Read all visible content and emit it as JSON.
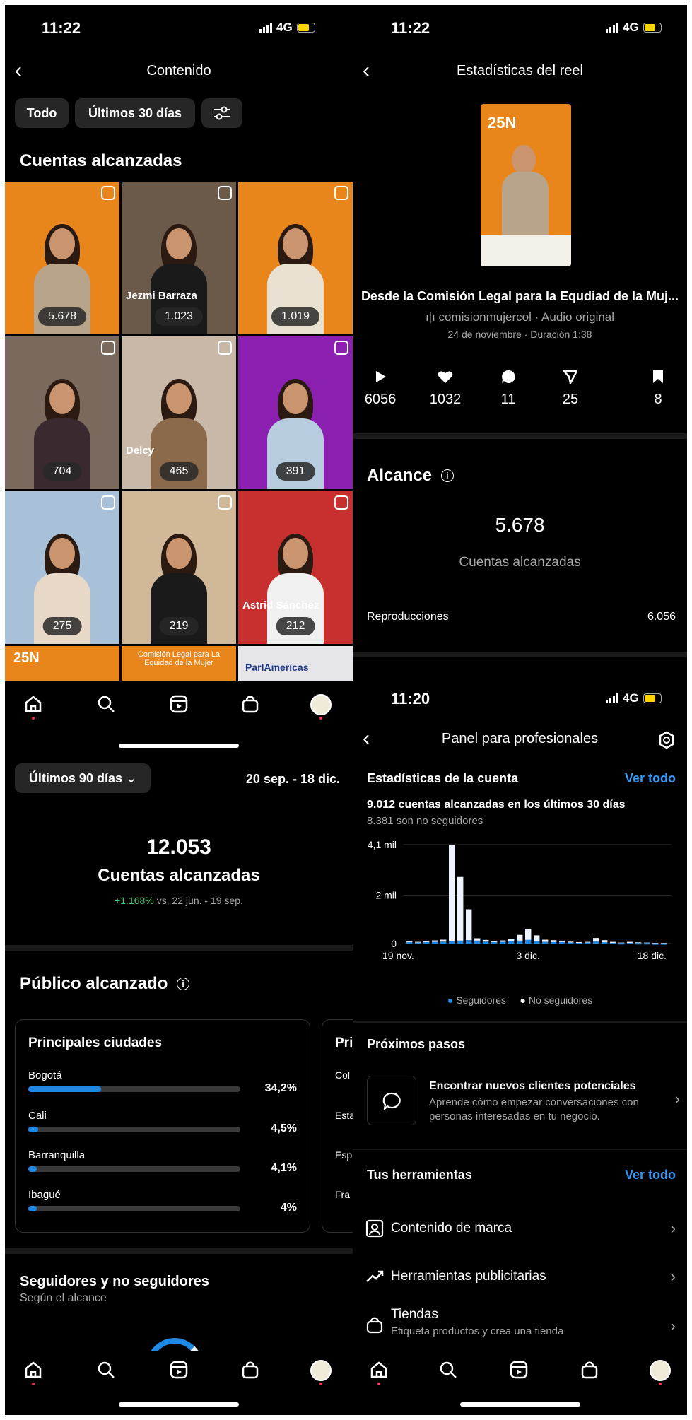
{
  "status": {
    "time_a": "11:22",
    "time_b": "11:22",
    "time_c": "11:20",
    "network": "4G"
  },
  "content": {
    "title": "Contenido",
    "filters": [
      "Todo",
      "Últimos 30 días"
    ],
    "section_title": "Cuentas alcanzadas",
    "tiles": [
      {
        "count": "5.678",
        "bg": "#e8861c",
        "body": "#b8a48a",
        "caption": ""
      },
      {
        "count": "1.023",
        "bg": "#6b5a4a",
        "body": "#1a1a1a",
        "caption": "Jezmi Barraza"
      },
      {
        "count": "1.019",
        "bg": "#e8861c",
        "body": "#e8e0d0",
        "caption": ""
      },
      {
        "count": "704",
        "bg": "#7a6a5e",
        "body": "#3a2a30",
        "caption": ""
      },
      {
        "count": "465",
        "bg": "#c8b8a8",
        "body": "#8a6a4a",
        "caption": "Delcy"
      },
      {
        "count": "391",
        "bg": "#8b1fb0",
        "body": "#b8cce0",
        "caption": ""
      },
      {
        "count": "275",
        "bg": "#a8c0d8",
        "body": "#e8d8c8",
        "caption": ""
      },
      {
        "count": "219",
        "bg": "#d0b898",
        "body": "#1a1a1a",
        "caption": ""
      },
      {
        "count": "212",
        "bg": "#c83030",
        "body": "#f0f0f0",
        "caption": "Astrid Sánchez"
      }
    ],
    "partial_row": [
      "25N",
      "Comisión Legal para La Equidad de la Mujer",
      "ParlAmericas"
    ]
  },
  "reel": {
    "title": "Estadísticas del reel",
    "caption": "Desde la Comisión Legal para la Equdiad de la Muj...",
    "audio": "comisionmujercol · Audio original",
    "meta": "24 de noviembre · Duración 1:38",
    "stats": [
      {
        "icon": "play-icon",
        "value": "6056"
      },
      {
        "icon": "heart-icon",
        "value": "1032"
      },
      {
        "icon": "comment-icon",
        "value": "11"
      },
      {
        "icon": "share-icon",
        "value": "25"
      },
      {
        "icon": "save-icon",
        "value": "8"
      }
    ],
    "reach_title": "Alcance",
    "reach_value": "5.678",
    "reach_label": "Cuentas alcanzadas",
    "plays_label": "Reproducciones",
    "plays_value": "6.056",
    "thumb_label": "25N"
  },
  "audience": {
    "range_label": "Últimos 90 días",
    "date_range": "20 sep. - 18 dic.",
    "total": "12.053",
    "total_label": "Cuentas alcanzadas",
    "delta": "+1.168%",
    "delta_suffix": "vs. 22 jun. - 19 sep.",
    "section_title": "Público alcanzado",
    "cities_title": "Principales ciudades",
    "cities": [
      {
        "name": "Bogotá",
        "pct": "34,2%",
        "fraction": 0.342
      },
      {
        "name": "Cali",
        "pct": "4,5%",
        "fraction": 0.045
      },
      {
        "name": "Barranquilla",
        "pct": "4,1%",
        "fraction": 0.041
      },
      {
        "name": "Ibagué",
        "pct": "4%",
        "fraction": 0.04
      }
    ],
    "next_card_title": "Pri",
    "next_card_rows": [
      "Col",
      "Esta",
      "Esp",
      "Fra"
    ],
    "followers_title": "Seguidores y no seguidores",
    "followers_sub": "Según el alcance"
  },
  "dashboard": {
    "title": "Panel para profesionales",
    "stats_title": "Estadísticas de la cuenta",
    "see_all": "Ver todo",
    "headline": "9.012 cuentas alcanzadas en los últimos 30 días",
    "sub": "8.381 son no seguidores",
    "legend_followers": "Seguidores",
    "legend_non": "No seguidores",
    "next_steps_title": "Próximos pasos",
    "next_card_title": "Encontrar nuevos clientes potenciales",
    "next_card_desc": "Aprende cómo empezar conversaciones con personas interesadas en tu negocio.",
    "tools_title": "Tus herramientas",
    "tools": [
      {
        "icon": "brand-content-icon",
        "label": "Contenido de marca",
        "sub": ""
      },
      {
        "icon": "ads-tools-icon",
        "label": "Herramientas publicitarias",
        "sub": ""
      },
      {
        "icon": "shop-icon",
        "label": "Tiendas",
        "sub": "Etiqueta productos y crea una tienda"
      }
    ]
  },
  "chart_data": {
    "type": "bar",
    "x_tick_labels": [
      "19 nov.",
      "3 dic.",
      "18 dic."
    ],
    "y_tick_labels": [
      "0",
      "2 mil",
      "4,1 mil"
    ],
    "ylim": [
      0,
      4100
    ],
    "series": [
      {
        "name": "Seguidores",
        "color": "#1e88e5",
        "values": [
          60,
          40,
          60,
          70,
          80,
          110,
          120,
          140,
          120,
          80,
          60,
          70,
          90,
          120,
          150,
          100,
          70,
          60,
          60,
          40,
          30,
          40,
          80,
          50,
          30,
          20,
          30,
          20,
          20,
          10,
          10
        ]
      },
      {
        "name": "No seguidores",
        "color": "#eef4ff",
        "values": [
          40,
          30,
          50,
          60,
          80,
          3980,
          2640,
          1280,
          100,
          70,
          50,
          60,
          90,
          240,
          460,
          240,
          90,
          80,
          60,
          40,
          30,
          30,
          150,
          90,
          40,
          20,
          40,
          30,
          20,
          20,
          20
        ]
      }
    ]
  }
}
